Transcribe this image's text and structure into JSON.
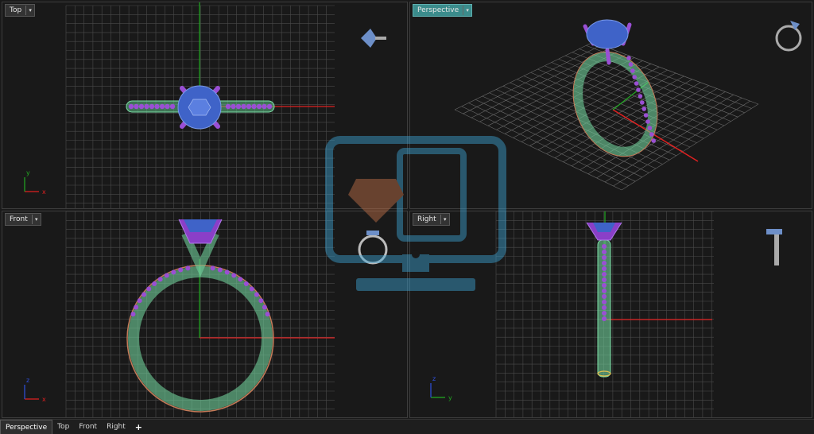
{
  "viewports": {
    "top": {
      "label": "Top"
    },
    "perspective": {
      "label": "Perspective"
    },
    "front": {
      "label": "Front"
    },
    "right": {
      "label": "Right"
    }
  },
  "axes": {
    "x": "x",
    "y": "y",
    "z": "z"
  },
  "dropdown_glyph": "▾",
  "tabs": [
    {
      "label": "Perspective",
      "active": true
    },
    {
      "label": "Top",
      "active": false
    },
    {
      "label": "Front",
      "active": false
    },
    {
      "label": "Right",
      "active": false
    }
  ],
  "add_tab_label": "+",
  "colors": {
    "background": "#191919",
    "grid": "#555555",
    "x_axis": "#e02020",
    "y_axis": "#22aa22",
    "gem": "#3f63c8",
    "prong": "#8a3fc8",
    "band": "#6fcf9a",
    "active_label": "#3b8c8c"
  }
}
